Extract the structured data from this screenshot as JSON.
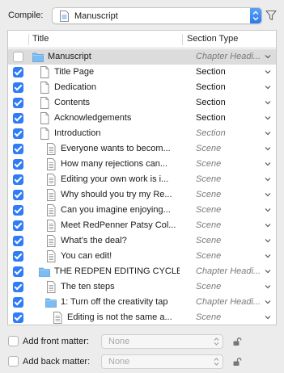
{
  "compile": {
    "label": "Compile:",
    "selected": "Manuscript"
  },
  "table": {
    "columns": {
      "title": "Title",
      "section_type": "Section Type"
    },
    "rows": [
      {
        "title": "Manuscript",
        "section_type": "Chapter Headi...",
        "checked": false,
        "icon": "folder-icon",
        "indent": 0,
        "style": "italic",
        "highlight": true
      },
      {
        "title": "Title Page",
        "section_type": "Section",
        "checked": true,
        "icon": "page-icon",
        "indent": 1,
        "style": "bold"
      },
      {
        "title": "Dedication",
        "section_type": "Section",
        "checked": true,
        "icon": "page-icon",
        "indent": 1,
        "style": "bold"
      },
      {
        "title": "Contents",
        "section_type": "Section",
        "checked": true,
        "icon": "page-icon",
        "indent": 1,
        "style": "bold"
      },
      {
        "title": "Acknowledgements",
        "section_type": "Section",
        "checked": true,
        "icon": "page-icon",
        "indent": 1,
        "style": "bold"
      },
      {
        "title": "Introduction",
        "section_type": "Section",
        "checked": true,
        "icon": "page-icon",
        "indent": 1,
        "style": "italic"
      },
      {
        "title": "Everyone wants to becom...",
        "section_type": "Scene",
        "checked": true,
        "icon": "text-doc-icon",
        "indent": 2,
        "style": "italic"
      },
      {
        "title": "How many rejections can...",
        "section_type": "Scene",
        "checked": true,
        "icon": "text-doc-icon",
        "indent": 2,
        "style": "italic"
      },
      {
        "title": "Editing your own work is i...",
        "section_type": "Scene",
        "checked": true,
        "icon": "text-doc-icon",
        "indent": 2,
        "style": "italic"
      },
      {
        "title": "Why should you try my Re...",
        "section_type": "Scene",
        "checked": true,
        "icon": "text-doc-icon",
        "indent": 2,
        "style": "italic"
      },
      {
        "title": "Can you imagine enjoying...",
        "section_type": "Scene",
        "checked": true,
        "icon": "text-doc-icon",
        "indent": 2,
        "style": "italic"
      },
      {
        "title": "Meet RedPenner Patsy Col...",
        "section_type": "Scene",
        "checked": true,
        "icon": "text-doc-icon",
        "indent": 2,
        "style": "italic"
      },
      {
        "title": "What’s the deal?",
        "section_type": "Scene",
        "checked": true,
        "icon": "text-doc-icon",
        "indent": 2,
        "style": "italic"
      },
      {
        "title": "You can edit!",
        "section_type": "Scene",
        "checked": true,
        "icon": "text-doc-icon",
        "indent": 2,
        "style": "italic"
      },
      {
        "title": "THE REDPEN EDITING CYCLE",
        "section_type": "Chapter Headi...",
        "checked": true,
        "icon": "folder-icon",
        "indent": 1,
        "style": "italic"
      },
      {
        "title": "The ten steps",
        "section_type": "Scene",
        "checked": true,
        "icon": "text-doc-icon",
        "indent": 2,
        "style": "italic"
      },
      {
        "title": "1: Turn off the creativity tap",
        "section_type": "Chapter Headi...",
        "checked": true,
        "icon": "folder-icon",
        "indent": 2,
        "style": "italic"
      },
      {
        "title": "Editing is not the same a...",
        "section_type": "Scene",
        "checked": true,
        "icon": "text-doc-icon",
        "indent": 3,
        "style": "italic"
      }
    ]
  },
  "front_matter": {
    "label": "Add front matter:",
    "value": "None",
    "checked": false
  },
  "back_matter": {
    "label": "Add back matter:",
    "value": "None",
    "checked": false
  },
  "colors": {
    "accent": "#2f7cf6",
    "folder": "#7bbcf2",
    "highlight_row": "#dcdcdc"
  }
}
